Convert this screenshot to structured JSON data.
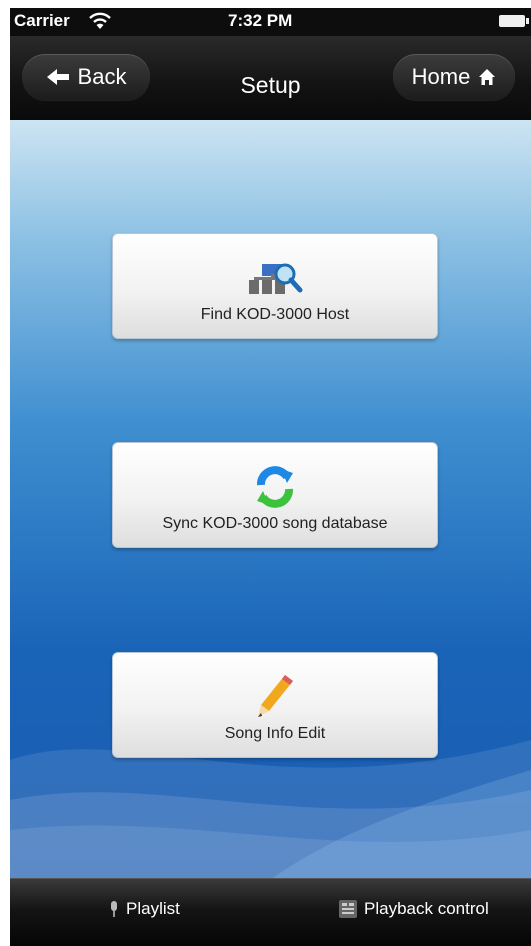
{
  "status_bar": {
    "carrier": "Carrier",
    "time": "7:32 PM",
    "wifi_icon": "wifi-icon",
    "battery_icon": "battery-icon"
  },
  "nav_bar": {
    "title": "Setup",
    "back_label": "Back",
    "home_label": "Home",
    "back_icon": "arrow-left-icon",
    "home_icon": "house-icon"
  },
  "buttons": [
    {
      "label": "Find KOD-3000 Host",
      "icon": "network-search-icon"
    },
    {
      "label": "Sync KOD-3000 song database",
      "icon": "sync-icon"
    },
    {
      "label": "Song Info Edit",
      "icon": "pencil-icon"
    }
  ],
  "tab_bar": {
    "items": [
      {
        "label": "Playlist",
        "icon": "microphone-icon"
      },
      {
        "label": "Playback control",
        "icon": "playback-control-icon"
      }
    ]
  },
  "colors": {
    "background_top": "#cde4f2",
    "background_bottom": "#1a5cb2",
    "bar_dark": "#0d0d0d",
    "sync_blue": "#1e88e5",
    "sync_green": "#3cc23c"
  }
}
